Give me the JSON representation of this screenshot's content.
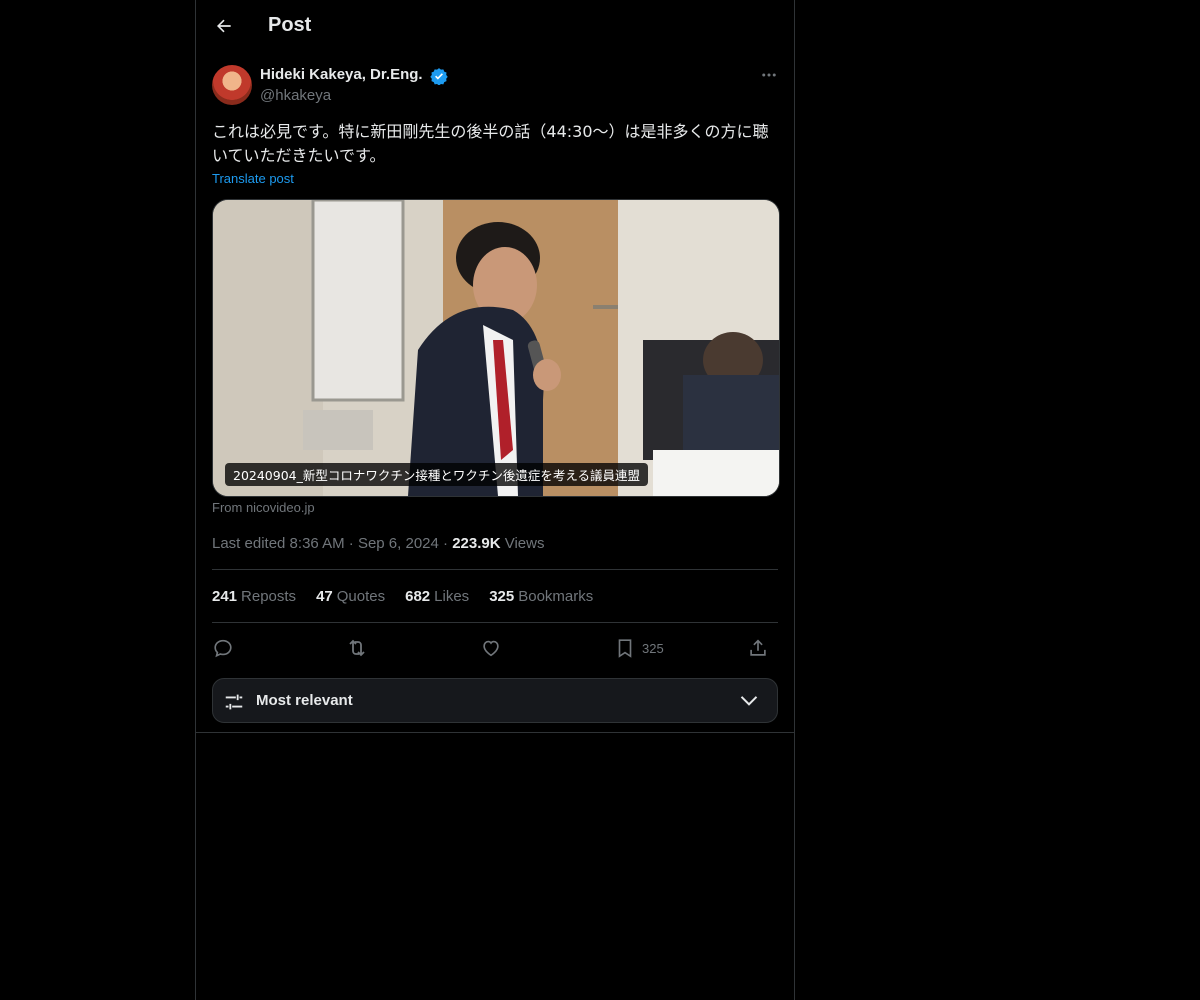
{
  "header": {
    "title": "Post"
  },
  "author": {
    "name": "Hideki Kakeya, Dr.Eng.",
    "handle": "@hkakeya"
  },
  "post": {
    "text": "これは必見です。特に新田剛先生の後半の話（44:30〜）は是非多くの方に聴いていただきたいです。",
    "translate_label": "Translate post",
    "media_caption": "20240904_新型コロナワクチン接種とワクチン後遺症を考える議員連盟",
    "media_source": "From nicovideo.jp"
  },
  "meta": {
    "edited": "Last edited 8:36 AM",
    "date": "Sep 6, 2024",
    "views_count": "223.9K",
    "views_label": "Views"
  },
  "stats": {
    "reposts": {
      "count": "241",
      "label": "Reposts"
    },
    "quotes": {
      "count": "47",
      "label": "Quotes"
    },
    "likes": {
      "count": "682",
      "label": "Likes"
    },
    "bookmarks": {
      "count": "325",
      "label": "Bookmarks"
    }
  },
  "actions": {
    "bookmark_count": "325"
  },
  "sort": {
    "label": "Most relevant"
  },
  "icons": [
    "back-arrow-icon",
    "verified-badge-icon",
    "more-icon",
    "reply-icon",
    "repost-icon",
    "like-icon",
    "bookmark-icon",
    "share-icon",
    "sort-sliders-icon",
    "chevron-down-icon"
  ],
  "colors": {
    "accent": "#1d9bf0",
    "background": "#000000",
    "muted": "#71767b"
  }
}
